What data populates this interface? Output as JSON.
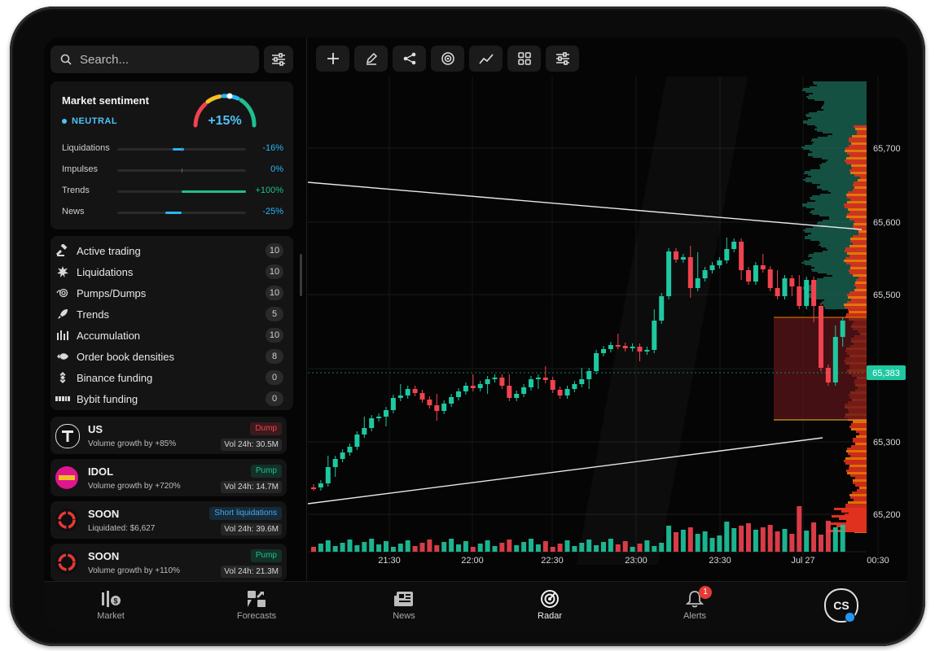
{
  "search": {
    "placeholder": "Search..."
  },
  "sentiment": {
    "title": "Market sentiment",
    "state": "NEUTRAL",
    "score": "+15%",
    "metrics": [
      {
        "label": "Liquidations",
        "value": "-16%",
        "color": "#29b6f6"
      },
      {
        "label": "Impulses",
        "value": "0%",
        "color": "#29b6f6"
      },
      {
        "label": "Trends",
        "value": "+100%",
        "color": "#1fbf8f"
      },
      {
        "label": "News",
        "value": "-25%",
        "color": "#29b6f6"
      }
    ]
  },
  "categories": [
    {
      "label": "Active trading",
      "count": "10",
      "icon": "gavel-icon"
    },
    {
      "label": "Liquidations",
      "count": "10",
      "icon": "explosion-icon"
    },
    {
      "label": "Pumps/Dumps",
      "count": "10",
      "icon": "wave-icon"
    },
    {
      "label": "Trends",
      "count": "5",
      "icon": "rocket-icon"
    },
    {
      "label": "Accumulation",
      "count": "10",
      "icon": "bars-icon"
    },
    {
      "label": "Order book densities",
      "count": "8",
      "icon": "fish-icon"
    },
    {
      "label": "Binance funding",
      "count": "0",
      "icon": "binance-icon"
    },
    {
      "label": "Bybit funding",
      "count": "0",
      "icon": "bybit-icon"
    }
  ],
  "assets": [
    {
      "name": "US",
      "desc": "Volume growth by +85%",
      "tag": "Dump",
      "tag_kind": "dump",
      "vol": "Vol 24h: 30.5M"
    },
    {
      "name": "IDOL",
      "desc": "Volume growth by +720%",
      "tag": "Pump",
      "tag_kind": "pump",
      "vol": "Vol 24h: 14.7M"
    },
    {
      "name": "SOON",
      "desc": "Liquidated: $6,627",
      "tag": "Short liquidations",
      "tag_kind": "liq",
      "vol": "Vol 24h: 39.6M"
    },
    {
      "name": "SOON",
      "desc": "Volume growth by +110%",
      "tag": "Pump",
      "tag_kind": "pump",
      "vol": "Vol 24h: 21.3M"
    }
  ],
  "toolbar": [
    "plus-icon",
    "pencil-icon",
    "share-icon",
    "target-icon",
    "line-chart-icon",
    "grid-icon",
    "sliders-icon"
  ],
  "nav": [
    {
      "label": "Market",
      "icon": "market-icon"
    },
    {
      "label": "Forecasts",
      "icon": "forecasts-icon"
    },
    {
      "label": "News",
      "icon": "news-icon"
    },
    {
      "label": "Radar",
      "icon": "radar-icon",
      "active": true
    },
    {
      "label": "Alerts",
      "icon": "bell-icon",
      "badge": "1"
    }
  ],
  "user": {
    "initials": "CS"
  },
  "chart_data": {
    "type": "candlestick",
    "y_ticks": [
      "65,700",
      "65,600",
      "65,500",
      "65,400",
      "65,300",
      "65,200"
    ],
    "x_ticks": [
      "21:30",
      "22:00",
      "22:30",
      "23:00",
      "23:30",
      "Jul 27",
      "00:30"
    ],
    "current_price": "65,383",
    "colors": {
      "up": "#1ec8a0",
      "down": "#f0434f"
    }
  }
}
